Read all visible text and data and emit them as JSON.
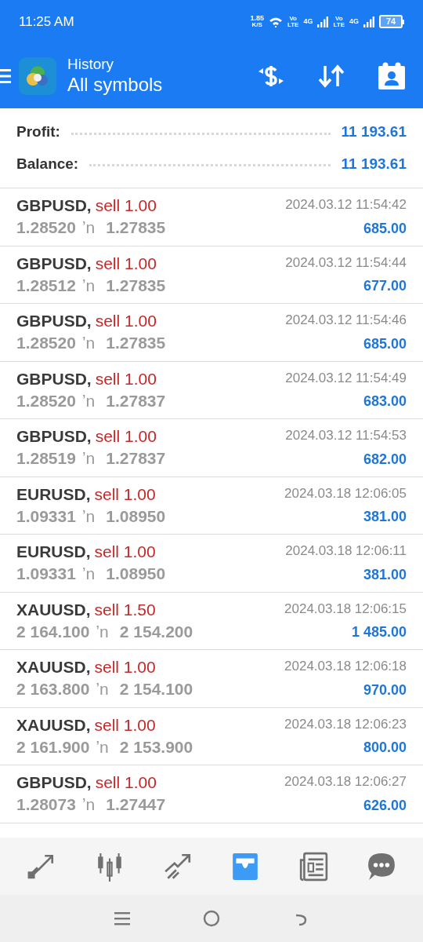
{
  "status_bar": {
    "time": "11:25 AM",
    "speed": "1.85",
    "speed_unit": "K/S",
    "sim1_volte": "Vo",
    "sim1_lte": "LTE",
    "sim1_network": "4G",
    "sim2_volte": "Vo",
    "sim2_lte": "LTE",
    "sim2_network": "4G",
    "battery": "74"
  },
  "app_bar": {
    "title": "History",
    "subtitle": "All symbols"
  },
  "summary": [
    {
      "label": "Profit:",
      "value": "11 193.61"
    },
    {
      "label": "Balance:",
      "value": "11 193.61"
    }
  ],
  "trades": [
    {
      "symbol": "GBPUSD,",
      "kind": "sell",
      "trade": "sell 1.00",
      "open_price": "1.28520",
      "arrow": "ʼn",
      "close_price": "1.27835",
      "time": "2024.03.12 11:54:42",
      "profit": "685.00"
    },
    {
      "symbol": "GBPUSD,",
      "kind": "sell",
      "trade": "sell 1.00",
      "open_price": "1.28512",
      "arrow": "ʼn",
      "close_price": "1.27835",
      "time": "2024.03.12 11:54:44",
      "profit": "677.00"
    },
    {
      "symbol": "GBPUSD,",
      "kind": "sell",
      "trade": "sell 1.00",
      "open_price": "1.28520",
      "arrow": "ʼn",
      "close_price": "1.27835",
      "time": "2024.03.12 11:54:46",
      "profit": "685.00"
    },
    {
      "symbol": "GBPUSD,",
      "kind": "sell",
      "trade": "sell 1.00",
      "open_price": "1.28520",
      "arrow": "ʼn",
      "close_price": "1.27837",
      "time": "2024.03.12 11:54:49",
      "profit": "683.00"
    },
    {
      "symbol": "GBPUSD,",
      "kind": "sell",
      "trade": "sell 1.00",
      "open_price": "1.28519",
      "arrow": "ʼn",
      "close_price": "1.27837",
      "time": "2024.03.12 11:54:53",
      "profit": "682.00"
    },
    {
      "symbol": "EURUSD,",
      "kind": "sell",
      "trade": "sell 1.00",
      "open_price": "1.09331",
      "arrow": "ʼn",
      "close_price": "1.08950",
      "time": "2024.03.18 12:06:05",
      "profit": "381.00"
    },
    {
      "symbol": "EURUSD,",
      "kind": "sell",
      "trade": "sell 1.00",
      "open_price": "1.09331",
      "arrow": "ʼn",
      "close_price": "1.08950",
      "time": "2024.03.18 12:06:11",
      "profit": "381.00"
    },
    {
      "symbol": "XAUUSD,",
      "kind": "sell",
      "trade": "sell 1.50",
      "open_price": "2 164.100",
      "arrow": "ʼn",
      "close_price": "2 154.200",
      "time": "2024.03.18 12:06:15",
      "profit": "1 485.00"
    },
    {
      "symbol": "XAUUSD,",
      "kind": "sell",
      "trade": "sell 1.00",
      "open_price": "2 163.800",
      "arrow": "ʼn",
      "close_price": "2 154.100",
      "time": "2024.03.18 12:06:18",
      "profit": "970.00"
    },
    {
      "symbol": "XAUUSD,",
      "kind": "sell",
      "trade": "sell 1.00",
      "open_price": "2 161.900",
      "arrow": "ʼn",
      "close_price": "2 153.900",
      "time": "2024.03.18 12:06:23",
      "profit": "800.00"
    },
    {
      "symbol": "GBPUSD,",
      "kind": "sell",
      "trade": "sell 1.00",
      "open_price": "1.28073",
      "arrow": "ʼn",
      "close_price": "1.27447",
      "time": "2024.03.18 12:06:27",
      "profit": "626.00"
    }
  ],
  "bottom_nav": [
    {
      "kind": "quotes",
      "selected": false
    },
    {
      "kind": "chart",
      "selected": false
    },
    {
      "kind": "trade",
      "selected": false
    },
    {
      "kind": "history",
      "selected": true
    },
    {
      "kind": "news",
      "selected": false
    },
    {
      "kind": "chat",
      "selected": false
    }
  ]
}
